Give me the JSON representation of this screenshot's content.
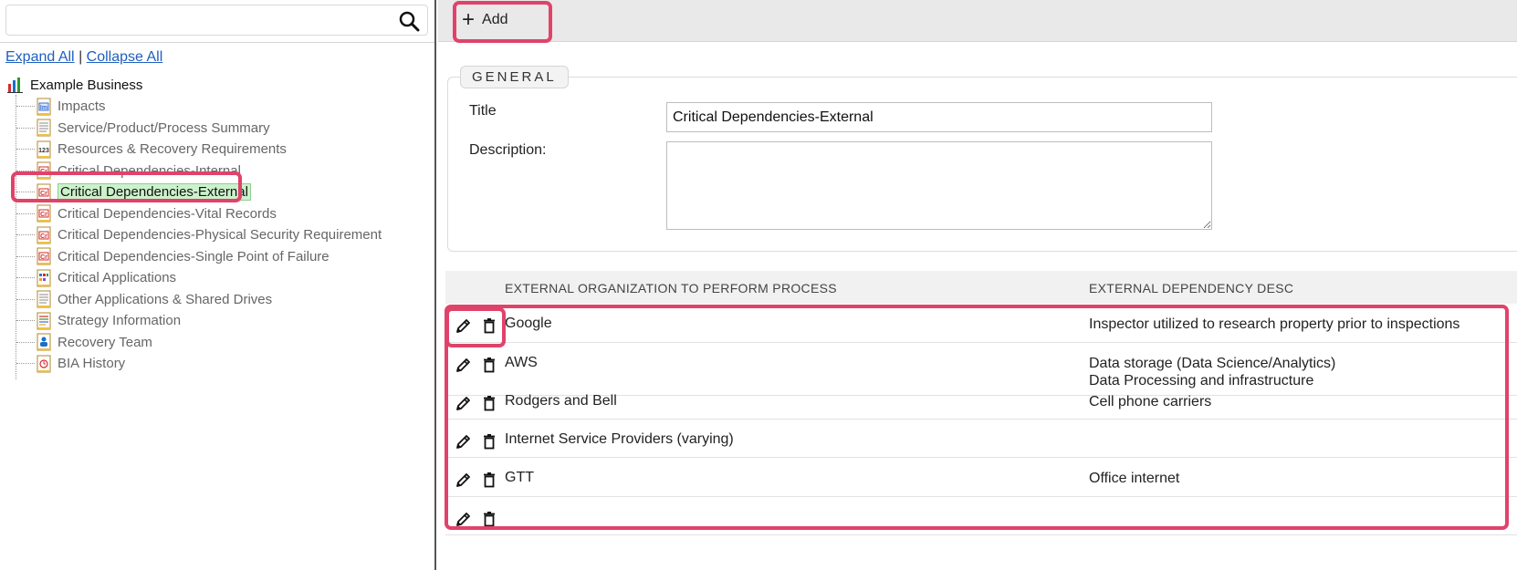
{
  "search": {
    "value": "",
    "placeholder": ""
  },
  "tree_controls": {
    "expand_all": "Expand All",
    "separator": "|",
    "collapse_all": "Collapse All"
  },
  "tree": {
    "root": "Example Business",
    "items": [
      {
        "label": "Impacts",
        "icon": "impacts-doc-icon"
      },
      {
        "label": "Service/Product/Process Summary",
        "icon": "summary-doc-icon"
      },
      {
        "label": "Resources & Recovery Requirements",
        "icon": "numbers-doc-icon"
      },
      {
        "label": "Critical Dependencies-Internal",
        "icon": "cr-doc-icon"
      },
      {
        "label": "Critical Dependencies-External",
        "icon": "cr-doc-icon",
        "selected": true
      },
      {
        "label": "Critical Dependencies-Vital Records",
        "icon": "cr-doc-icon"
      },
      {
        "label": "Critical Dependencies-Physical Security Requirement",
        "icon": "cr-doc-icon"
      },
      {
        "label": "Critical Dependencies-Single Point of Failure",
        "icon": "cr-doc-icon"
      },
      {
        "label": "Critical Applications",
        "icon": "apps-doc-icon"
      },
      {
        "label": "Other Applications & Shared Drives",
        "icon": "list-doc-icon"
      },
      {
        "label": "Strategy Information",
        "icon": "strategy-doc-icon"
      },
      {
        "label": "Recovery Team",
        "icon": "team-doc-icon"
      },
      {
        "label": "BIA History",
        "icon": "history-doc-icon"
      }
    ]
  },
  "toolbar": {
    "add_label": "Add"
  },
  "general": {
    "legend": "GENERAL",
    "title_label": "Title",
    "title_value": "Critical Dependencies-External",
    "description_label": "Description:",
    "description_value": ""
  },
  "table": {
    "columns": [
      "EXTERNAL ORGANIZATION TO PERFORM PROCESS",
      "EXTERNAL DEPENDENCY DESC"
    ],
    "rows": [
      {
        "org": "Google",
        "desc": [
          "Inspector utilized to research property prior to inspections"
        ]
      },
      {
        "org": "AWS",
        "desc": [
          "Data storage (Data Science/Analytics)",
          "Data Processing and infrastructure"
        ]
      },
      {
        "org": "Rodgers and Bell",
        "desc": [
          "Cell phone carriers"
        ]
      },
      {
        "org": "Internet Service Providers (varying)",
        "desc": [
          ""
        ]
      },
      {
        "org": "GTT",
        "desc": [
          "Office internet"
        ]
      },
      {
        "org": "",
        "desc": [
          ""
        ]
      }
    ]
  },
  "colors": {
    "highlight": "#e0436a",
    "selected_bg": "#ccf2cc",
    "link": "#1f5fbf"
  }
}
